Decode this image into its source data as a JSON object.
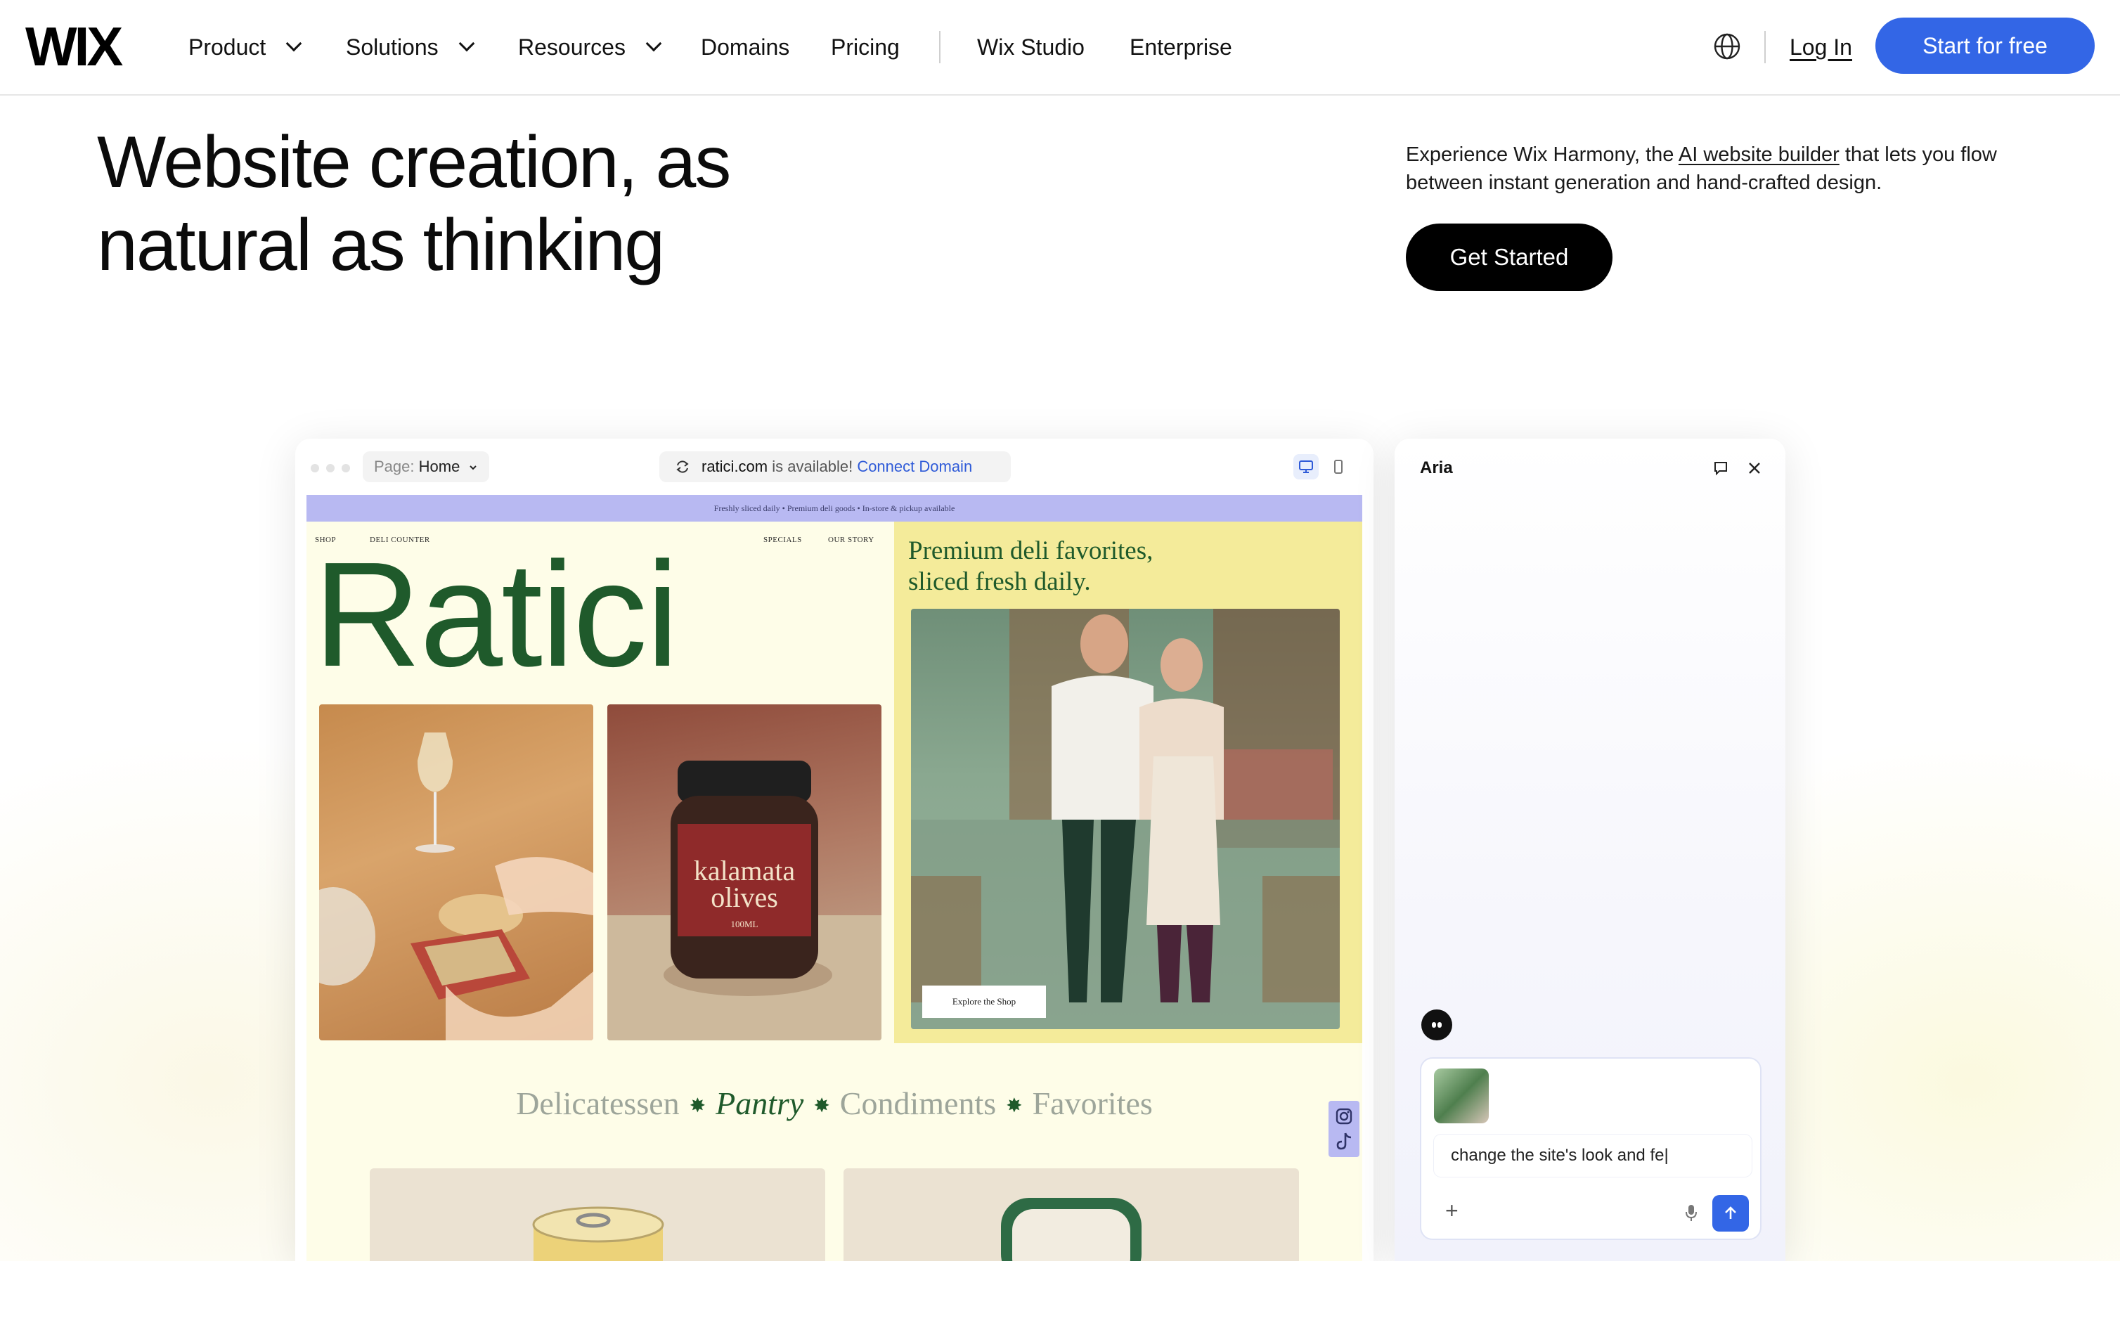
{
  "nav": {
    "logo": "WIX",
    "items": [
      {
        "label": "Product",
        "dropdown": true
      },
      {
        "label": "Solutions",
        "dropdown": true
      },
      {
        "label": "Resources",
        "dropdown": true
      },
      {
        "label": "Domains",
        "dropdown": false
      },
      {
        "label": "Pricing",
        "dropdown": false
      },
      {
        "label": "Wix Studio",
        "dropdown": false
      },
      {
        "label": "Enterprise",
        "dropdown": false
      }
    ],
    "language_icon": "globe-icon",
    "login": "Log In",
    "cta": "Start for free",
    "accent_color": "#3366e6"
  },
  "hero": {
    "title_line1": "Website creation, as",
    "title_line2": "natural as thinking",
    "description_pre": "Experience Wix Harmony, the ",
    "description_link": "AI website builder",
    "description_post": " that lets you flow between instant generation and hand-crafted design.",
    "cta": "Get Started"
  },
  "editor": {
    "page_label": "Page:",
    "page_value": "Home",
    "domain": "ratici.com",
    "domain_status": " is available! ",
    "connect": "Connect Domain",
    "site": {
      "promo": "Freshly sliced daily • Premium deli goods • In-store & pickup available",
      "nav_left": [
        "SHOP",
        "DELI COUNTER"
      ],
      "nav_right": [
        "SPECIALS",
        "OUR STORY"
      ],
      "brand": "Ratici",
      "tagline": "Premium deli favorites, sliced fresh daily.",
      "jar_label_1": "kalamata",
      "jar_label_2": "olives",
      "jar_label_3": "100ML",
      "explore": "Explore the Shop",
      "categories": [
        "Delicatessen",
        "Pantry",
        "Condiments",
        "Favorites"
      ],
      "active_category": "Pantry",
      "brand_color": "#1f5a2b"
    }
  },
  "chat": {
    "title": "Aria",
    "prompt": "change the site's look and fe|",
    "plus": "+"
  }
}
